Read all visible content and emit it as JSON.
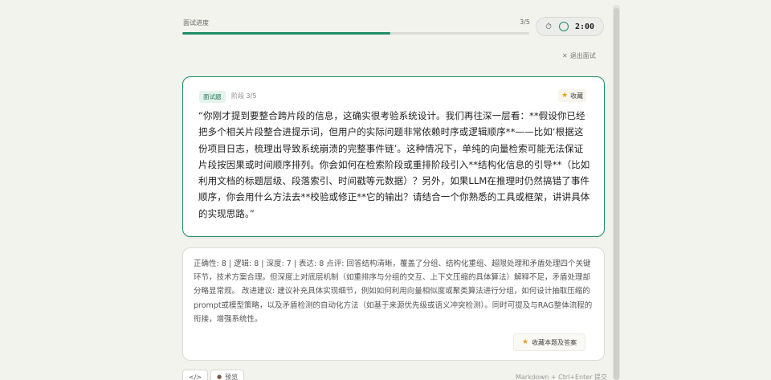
{
  "progress": {
    "label": "面试进度",
    "count": "3/5",
    "value": 0.6
  },
  "timer": {
    "icon": "stopwatch-icon",
    "value": "2:00"
  },
  "exit_label": "退出面试",
  "question": {
    "tag": "面试题",
    "stage": "阶段 3/5",
    "favorite_label": "收藏",
    "text": "“你刚才提到要整合跨片段的信息，这确实很考验系统设计。我们再往深一层看：**假设你已经把多个相关片段整合进提示词，但用户的实际问题非常依赖时序或逻辑顺序**——比如‘根据这份项目日志，梳理出导致系统崩溃的完整事件链’。这种情况下，单纯的向量检索可能无法保证片段按因果或时间顺序排列。你会如何在检索阶段或重排阶段引入**结构化信息的引导**（比如利用文档的标题层级、段落索引、时间戳等元数据）？另外，如果LLM在推理时仍然搞错了事件顺序，你会用什么方法去**校验或修正**它的输出？请结合一个你熟悉的工具或框架，讲讲具体的实现思路。”"
  },
  "feedback": {
    "text": "正确性: 8 | 逻辑: 8 | 深度: 7 | 表达: 8 点评: 回答结构清晰，覆盖了分组、结构化重组、超限处理和矛盾处理四个关键环节，技术方案合理。但深度上对底层机制（如重排序与分组的交互、上下文压缩的具体算法）解释不足，矛盾处理部分略显常规。 改进建议: 建议补充具体实现细节，例如如何利用向量相似度或聚类算法进行分组，如何设计抽取压缩的prompt或模型策略，以及矛盾检测的自动化方法（如基于来源优先级或语义冲突检测）。同时可提及与RAG整体流程的衔接，增强系统性。",
    "favorite_button": "收藏本题及答案"
  },
  "toolbar": {
    "code_label": "</>",
    "preview_label": "预览",
    "hint": "Markdown + Ctrl+Enter 提交"
  },
  "colors": {
    "accent": "#1e8c67",
    "star": "#e8a317",
    "background": "#f3f3ee"
  }
}
